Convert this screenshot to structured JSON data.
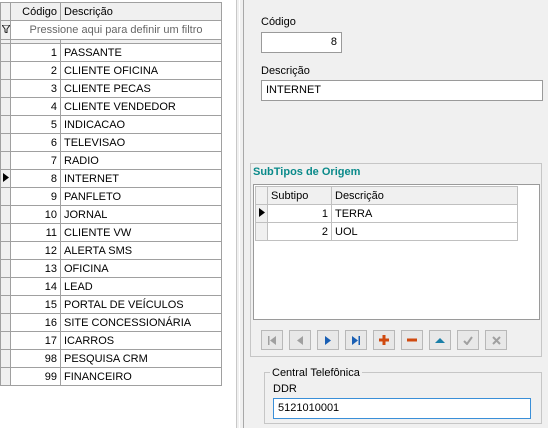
{
  "grid": {
    "columns": [
      "Código",
      "Descrição"
    ],
    "filter_placeholder": "Pressione aqui para definir um filtro",
    "rows": [
      {
        "codigo": "1",
        "descricao": "PASSANTE"
      },
      {
        "codigo": "2",
        "descricao": "CLIENTE OFICINA"
      },
      {
        "codigo": "3",
        "descricao": "CLIENTE PECAS"
      },
      {
        "codigo": "4",
        "descricao": "CLIENTE VENDEDOR"
      },
      {
        "codigo": "5",
        "descricao": "INDICACAO"
      },
      {
        "codigo": "6",
        "descricao": "TELEVISAO"
      },
      {
        "codigo": "7",
        "descricao": "RADIO"
      },
      {
        "codigo": "8",
        "descricao": "INTERNET"
      },
      {
        "codigo": "9",
        "descricao": "PANFLETO"
      },
      {
        "codigo": "10",
        "descricao": "JORNAL"
      },
      {
        "codigo": "11",
        "descricao": "CLIENTE VW"
      },
      {
        "codigo": "12",
        "descricao": "ALERTA SMS"
      },
      {
        "codigo": "13",
        "descricao": "OFICINA"
      },
      {
        "codigo": "14",
        "descricao": "LEAD"
      },
      {
        "codigo": "15",
        "descricao": "PORTAL DE VEÍCULOS"
      },
      {
        "codigo": "16",
        "descricao": "SITE CONCESSIONÁRIA"
      },
      {
        "codigo": "17",
        "descricao": "ICARROS"
      },
      {
        "codigo": "98",
        "descricao": "PESQUISA CRM"
      },
      {
        "codigo": "99",
        "descricao": "FINANCEIRO"
      }
    ]
  },
  "form": {
    "codigo_label": "Código",
    "codigo_value": "8",
    "descricao_label": "Descrição",
    "descricao_value": "INTERNET"
  },
  "subtipos": {
    "title": "SubTipos de Origem",
    "columns": [
      "Subtipo",
      "Descrição"
    ],
    "rows": [
      {
        "subtipo": "1",
        "descricao": "TERRA"
      },
      {
        "subtipo": "2",
        "descricao": "UOL"
      }
    ]
  },
  "navigator": {
    "buttons": [
      "first-icon",
      "prior-icon",
      "next-icon",
      "last-icon",
      "insert-icon",
      "delete-icon",
      "edit-icon",
      "post-icon",
      "cancel-icon"
    ],
    "colors": {
      "blue": "#1a5fb4",
      "red": "#d04a10",
      "gray": "#a0a0a0",
      "teal": "#1a7fa8"
    }
  },
  "central": {
    "group_title": "Central Telefônica",
    "ddr_label": "DDR",
    "ddr_value": "5121010001"
  }
}
